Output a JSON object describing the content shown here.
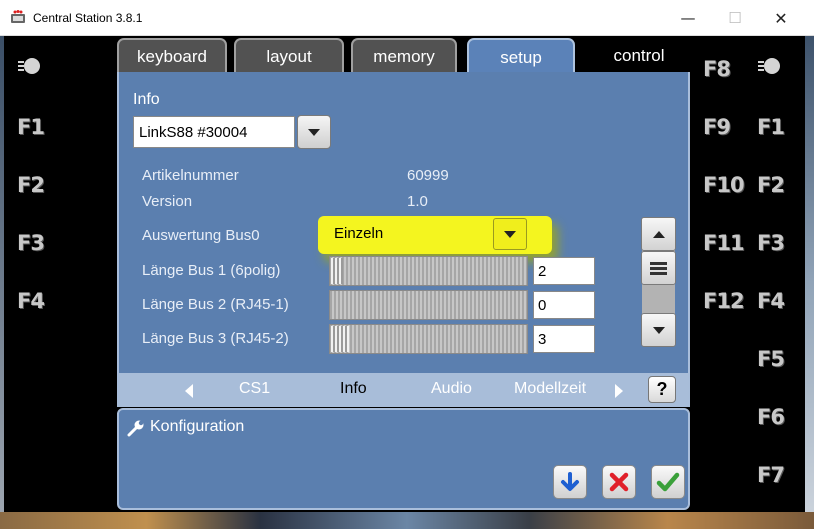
{
  "window": {
    "title": "Central Station 3.8.1",
    "minimize_glyph": "—",
    "maximize_glyph": "☐",
    "close_glyph": "✕"
  },
  "tabs": [
    {
      "label": "keyboard",
      "state": "inactive"
    },
    {
      "label": "layout",
      "state": "inactive"
    },
    {
      "label": "memory",
      "state": "inactive"
    },
    {
      "label": "setup",
      "state": "active"
    },
    {
      "label": "control",
      "state": "plain"
    }
  ],
  "function_keys": {
    "left": [
      "F1",
      "F2",
      "F3",
      "F4"
    ],
    "right_inner": [
      "F8",
      "F9",
      "F10",
      "F11",
      "F12"
    ],
    "right_outer": [
      "F1",
      "F2",
      "F3",
      "F4",
      "F5",
      "F6",
      "F7"
    ]
  },
  "info": {
    "heading": "Info",
    "device_select": "LinkS88 #30004",
    "rows": [
      {
        "label": "Artikelnummer",
        "value": "60999"
      },
      {
        "label": "Version",
        "value": "1.0"
      }
    ],
    "bus_eval": {
      "label": "Auswertung Bus0",
      "value": "Einzeln"
    },
    "bus_lengths": [
      {
        "label": "Länge Bus 1 (6polig)",
        "value": "2",
        "level": 2
      },
      {
        "label": "Länge Bus 2 (RJ45-1)",
        "value": "0",
        "level": 0
      },
      {
        "label": "Länge Bus 3 (RJ45-2)",
        "value": "3",
        "level": 3
      }
    ]
  },
  "nav": {
    "items": [
      "CS1",
      "Info",
      "Audio",
      "Modellzeit"
    ],
    "current": "Info",
    "help": "?"
  },
  "konfiguration": {
    "title": "Konfiguration"
  },
  "colors": {
    "panel": "#5b7faf",
    "highlight": "#f4f51f",
    "navbar": "#a8bdd9",
    "confirm": "#3aa03a",
    "cancel": "#e0202a",
    "download": "#1e5fd1"
  }
}
